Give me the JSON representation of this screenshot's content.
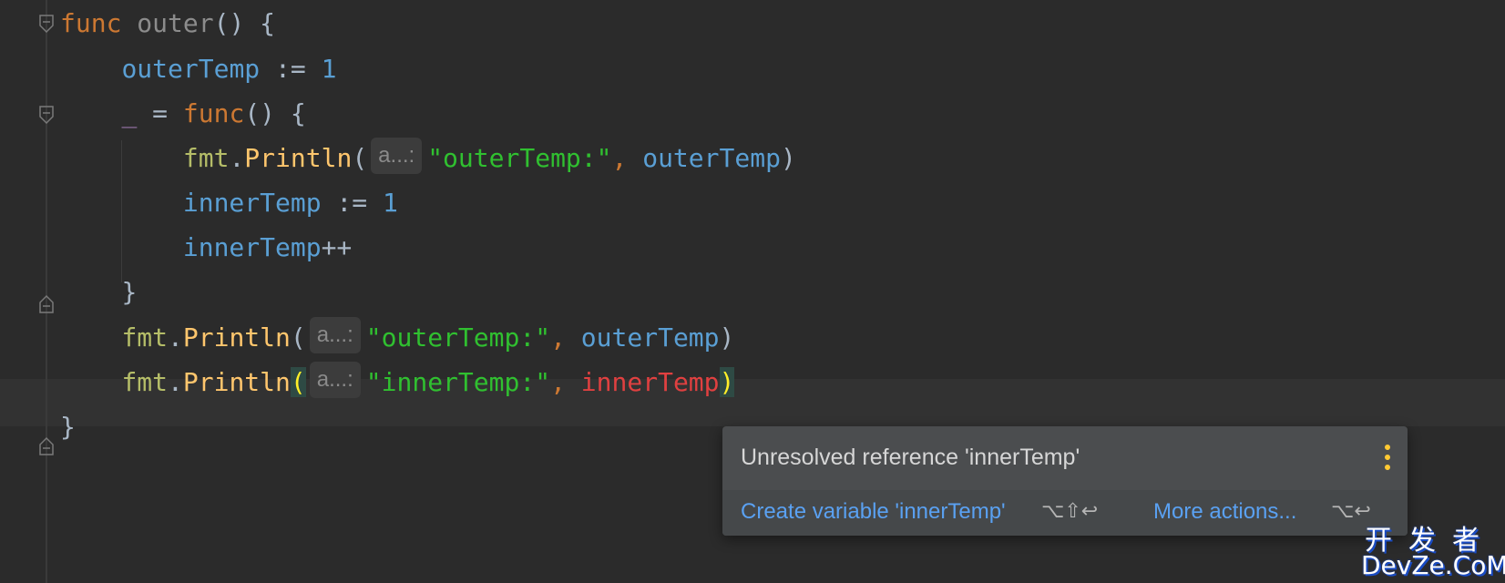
{
  "editor": {
    "lines": [
      {
        "tokens": [
          {
            "text": "func",
            "cls": "kw"
          },
          {
            "text": " "
          },
          {
            "text": "outer",
            "cls": "fn-dim"
          },
          {
            "text": "() {"
          }
        ]
      },
      {
        "tokens": [
          {
            "text": "    "
          },
          {
            "text": "outerTemp",
            "cls": "var"
          },
          {
            "text": " := "
          },
          {
            "text": "1",
            "cls": "num"
          }
        ]
      },
      {
        "tokens": [
          {
            "text": "    "
          },
          {
            "text": "_",
            "cls": "under"
          },
          {
            "text": " = "
          },
          {
            "text": "func",
            "cls": "kw"
          },
          {
            "text": "() {"
          }
        ]
      },
      {
        "tokens": [
          {
            "text": "        "
          },
          {
            "text": "fmt",
            "cls": "pkg"
          },
          {
            "text": "."
          },
          {
            "text": "Println",
            "cls": "call"
          },
          {
            "text": "("
          },
          {
            "hint": "a...:"
          },
          {
            "text": "\"outerTemp:\"",
            "cls": "str"
          },
          {
            "text": ", ",
            "cls": "kw"
          },
          {
            "text": "outerTemp",
            "cls": "var"
          },
          {
            "text": ")"
          }
        ]
      },
      {
        "tokens": [
          {
            "text": "        "
          },
          {
            "text": "innerTemp",
            "cls": "var"
          },
          {
            "text": " := "
          },
          {
            "text": "1",
            "cls": "num"
          }
        ]
      },
      {
        "tokens": [
          {
            "text": "        "
          },
          {
            "text": "innerTemp",
            "cls": "var"
          },
          {
            "text": "++"
          }
        ]
      },
      {
        "tokens": [
          {
            "text": "    "
          },
          {
            "text": "}"
          }
        ]
      },
      {
        "tokens": [
          {
            "text": "    "
          },
          {
            "text": "fmt",
            "cls": "pkg"
          },
          {
            "text": "."
          },
          {
            "text": "Println",
            "cls": "call"
          },
          {
            "text": "("
          },
          {
            "hint": "a...:"
          },
          {
            "text": "\"outerTemp:\"",
            "cls": "str"
          },
          {
            "text": ", ",
            "cls": "kw"
          },
          {
            "text": "outerTemp",
            "cls": "var"
          },
          {
            "text": ")"
          }
        ]
      },
      {
        "tokens": [
          {
            "text": "    "
          },
          {
            "text": "fmt",
            "cls": "pkg"
          },
          {
            "text": "."
          },
          {
            "text": "Println",
            "cls": "call"
          },
          {
            "text": "(",
            "cls": "brace-hl"
          },
          {
            "hint": "a...:"
          },
          {
            "text": "\"innerTemp:\"",
            "cls": "str"
          },
          {
            "text": ", ",
            "cls": "kw"
          },
          {
            "text": "innerTemp",
            "cls": "err"
          },
          {
            "text": ")",
            "cls": "brace-hl"
          }
        ]
      },
      {
        "tokens": [
          {
            "text": "}"
          }
        ]
      }
    ]
  },
  "popup": {
    "message": "Unresolved reference 'innerTemp'",
    "primary_action": "Create variable 'innerTemp'",
    "primary_shortcut": "⌥⇧↩",
    "secondary_action": "More actions...",
    "secondary_shortcut": "⌥↩",
    "menu_icon": "more-vertical-icon"
  },
  "watermark": {
    "cn": "开发者",
    "en": "DevZe.CoM"
  },
  "colors": {
    "background": "#2b2b2b",
    "keyword": "#cc7832",
    "variable": "#5a9fd4",
    "string": "#30c030",
    "error": "#e04040",
    "link": "#5aa1f2"
  }
}
